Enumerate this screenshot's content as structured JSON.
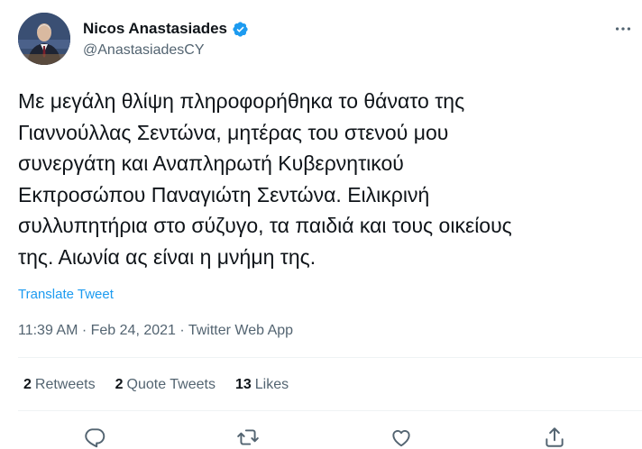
{
  "user": {
    "display_name": "Nicos Anastasiades",
    "handle": "@AnastasiadesCY",
    "verified": true
  },
  "tweet": {
    "text": "Με μεγάλη θλίψη πληροφορήθηκα το θάνατο της\nΓιαννούλλας Σεντώνα, μητέρας του στενού μου\nσυνεργάτη και Αναπληρωτή Κυβερνητικού\nΕκπροσώπου Παναγιώτη Σεντώνα. Ειλικρινή\nσυλλυπητήρια στο σύζυγο, τα παιδιά και τους οικείους\nτης. Αιωνία ας είναι η μνήμη της.",
    "translate_label": "Translate Tweet",
    "timestamp": "11:39 AM · Feb 24, 2021 · Twitter Web App"
  },
  "stats": {
    "retweets_count": "2",
    "retweets_label": "Retweets",
    "quote_count": "2",
    "quote_label": "Quote Tweets",
    "likes_count": "13",
    "likes_label": "Likes"
  },
  "icons": {
    "more": "more-horizontal-icon",
    "reply": "reply-icon",
    "retweet": "retweet-icon",
    "like": "heart-icon",
    "share": "share-icon",
    "verified": "verified-badge-icon"
  },
  "colors": {
    "accent": "#1d9bf0",
    "text_primary": "#0f1419",
    "text_secondary": "#536471",
    "divider": "#eff3f4"
  }
}
